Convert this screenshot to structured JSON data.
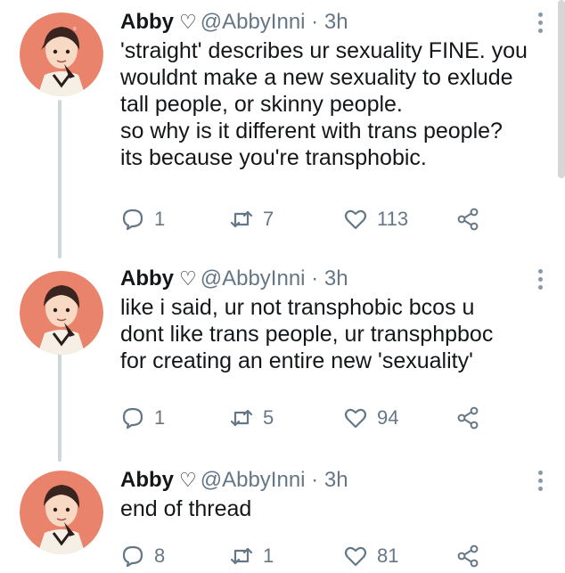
{
  "tweets": [
    {
      "name": "Abby",
      "handle": "@AbbyInni",
      "sep": "·",
      "time": "3h",
      "text": "'straight' describes ur sexuality FINE. you\nwouldnt make a new sexuality to exlude\ntall people, or skinny people.\n so why is it different with trans people?\nits because you're transphobic.",
      "replies": "1",
      "retweets": "7",
      "likes": "113"
    },
    {
      "name": "Abby",
      "handle": "@AbbyInni",
      "sep": "·",
      "time": "3h",
      "text": "like i said, ur not transphobic bcos u\ndont like trans people, ur transphpboc\nfor creating an entire new 'sexuality'",
      "replies": "1",
      "retweets": "5",
      "likes": "94"
    },
    {
      "name": "Abby",
      "handle": "@AbbyInni",
      "sep": "·",
      "time": "3h",
      "text": "end of thread",
      "replies": "8",
      "retweets": "1",
      "likes": "81"
    }
  ],
  "colors": {
    "text": "#14171a",
    "muted": "#657786",
    "thread_line": "#cdd6dd",
    "avatar_bg": "#e9836b"
  },
  "icons": [
    "heart-outline-icon",
    "reply-icon",
    "retweet-icon",
    "like-icon",
    "share-icon",
    "more-vertical-icon"
  ]
}
